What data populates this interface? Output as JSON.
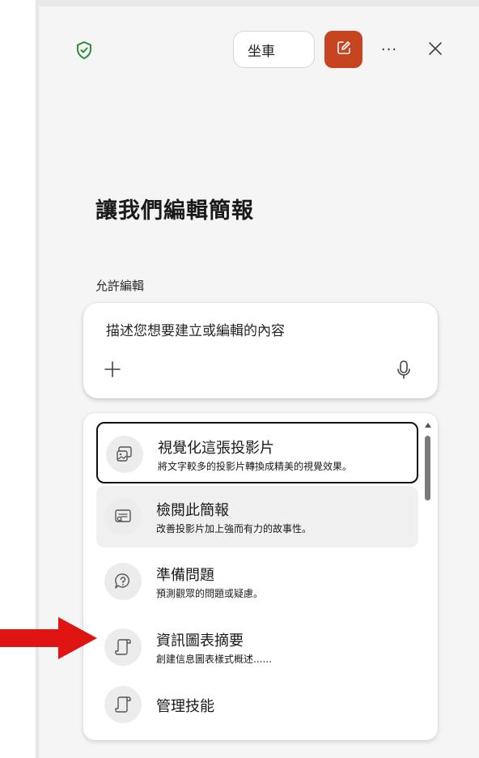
{
  "toolbar": {
    "mode_label": "坐車",
    "more_label": "···"
  },
  "main": {
    "heading": "讓我們編輯簡報",
    "permission_label": "允許編輯"
  },
  "prompt": {
    "placeholder": "描述您想要建立或編輯的內容"
  },
  "menu": {
    "items": [
      {
        "title": "視覺化這張投影片",
        "description": "將文字較多的投影片轉換成精美的視覺效果。",
        "icon": "image-slide-icon"
      },
      {
        "title": "檢閱此簡報",
        "description": "改善投影片加上強而有力的故事性。",
        "icon": "review-slide-icon"
      },
      {
        "title": "準備問題",
        "description": "預測觀眾的問題或疑慮。",
        "icon": "question-bubble-icon"
      },
      {
        "title": "資訊圖表摘要",
        "description": "創建信息圖表樣式概述......",
        "icon": "scroll-icon"
      },
      {
        "title": "管理技能",
        "description": "",
        "icon": "scroll-icon"
      }
    ]
  },
  "colors": {
    "accent": "#c64420",
    "shield": "#2e8b3e",
    "arrow": "#e11414"
  }
}
